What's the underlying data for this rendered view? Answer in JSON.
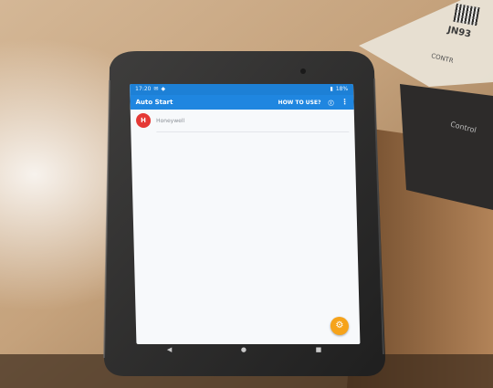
{
  "scene": {
    "box_text": "JN93",
    "box_subtext": "CONTR",
    "control_text": "Control"
  },
  "phone": {
    "status_time": "17:20",
    "status_battery": "18%",
    "app_title": "Auto Start",
    "how_to_use": "HOW TO USE?",
    "list": [
      {
        "badge": "H",
        "label": "Honeywell"
      }
    ],
    "fab_icon": "gear-icon"
  }
}
